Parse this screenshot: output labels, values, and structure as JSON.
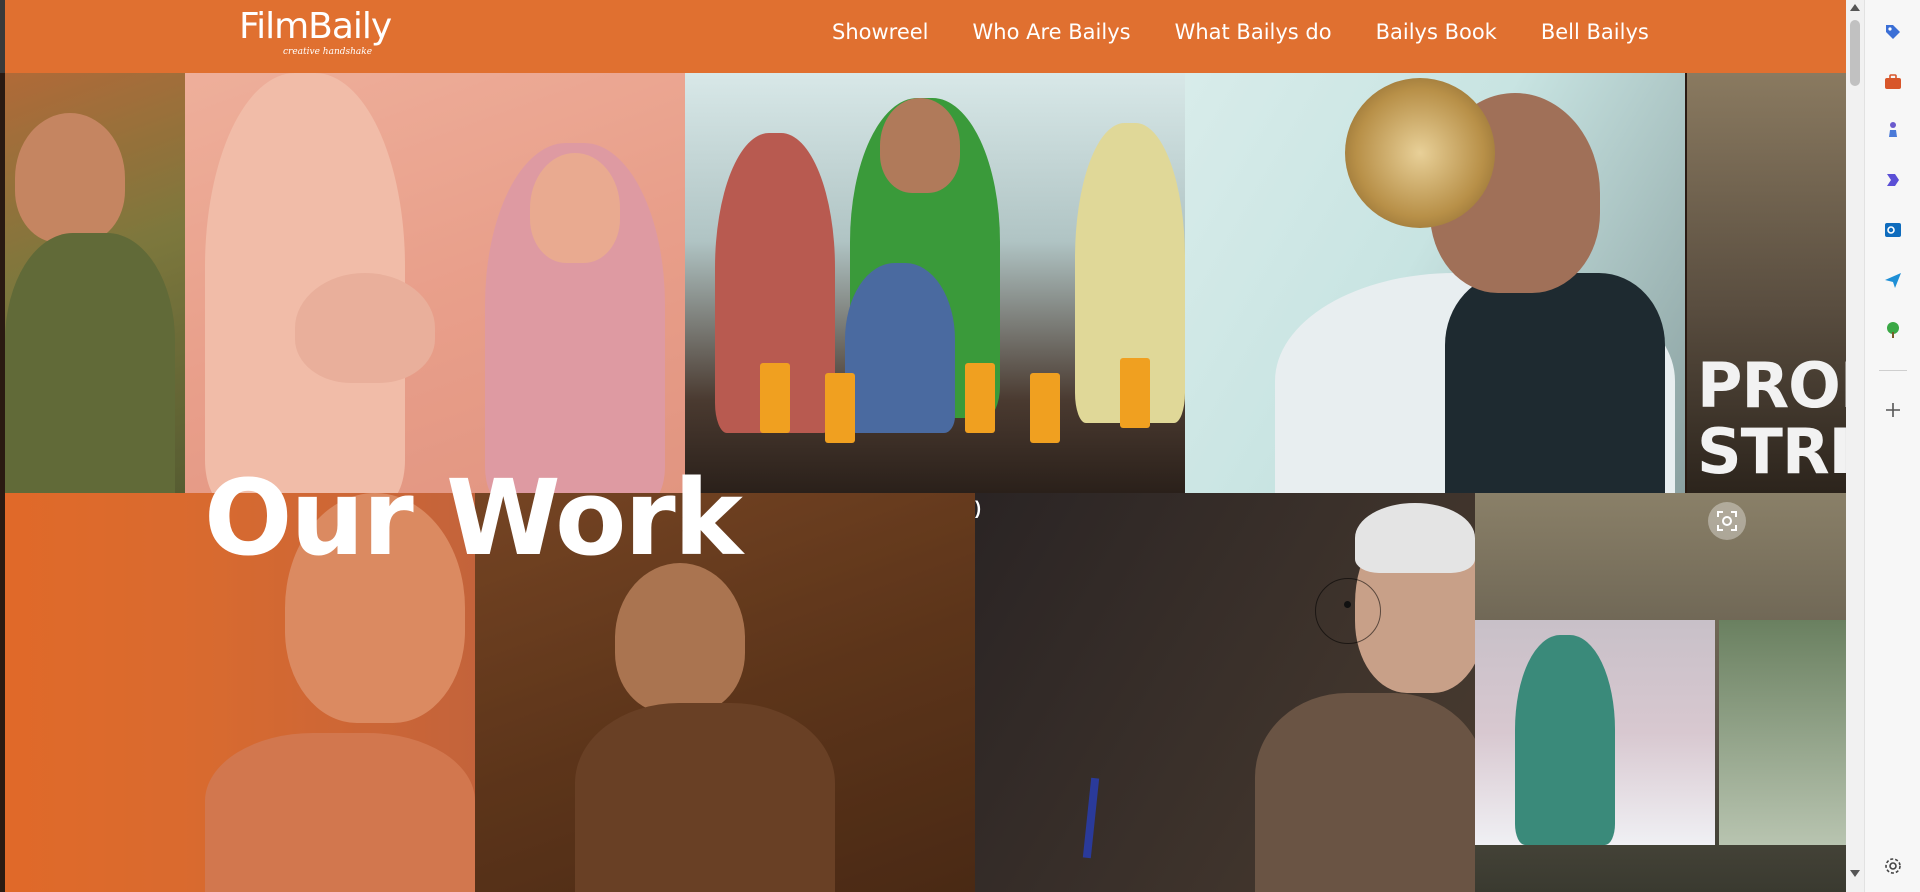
{
  "header": {
    "logo_text": "FilmBaily",
    "logo_tagline": "creative handshake",
    "nav": [
      {
        "label": "Showreel"
      },
      {
        "label": "Who Are Bailys"
      },
      {
        "label": "What Bailys do"
      },
      {
        "label": "Bailys Book"
      },
      {
        "label": "Bell Bailys"
      }
    ]
  },
  "hero": {
    "headline": "Our Work",
    "tile_text": [
      "PRODU",
      "STRICK"
    ],
    "bracket": ")"
  },
  "colors": {
    "header_bg": "#e07030",
    "headline": "#ffffff"
  },
  "sidebar": {
    "icons": [
      "tag-icon",
      "briefcase-icon",
      "chess-icon",
      "copilot-icon",
      "outlook-icon",
      "send-icon",
      "tree-icon",
      "add-icon",
      "settings-icon"
    ]
  }
}
